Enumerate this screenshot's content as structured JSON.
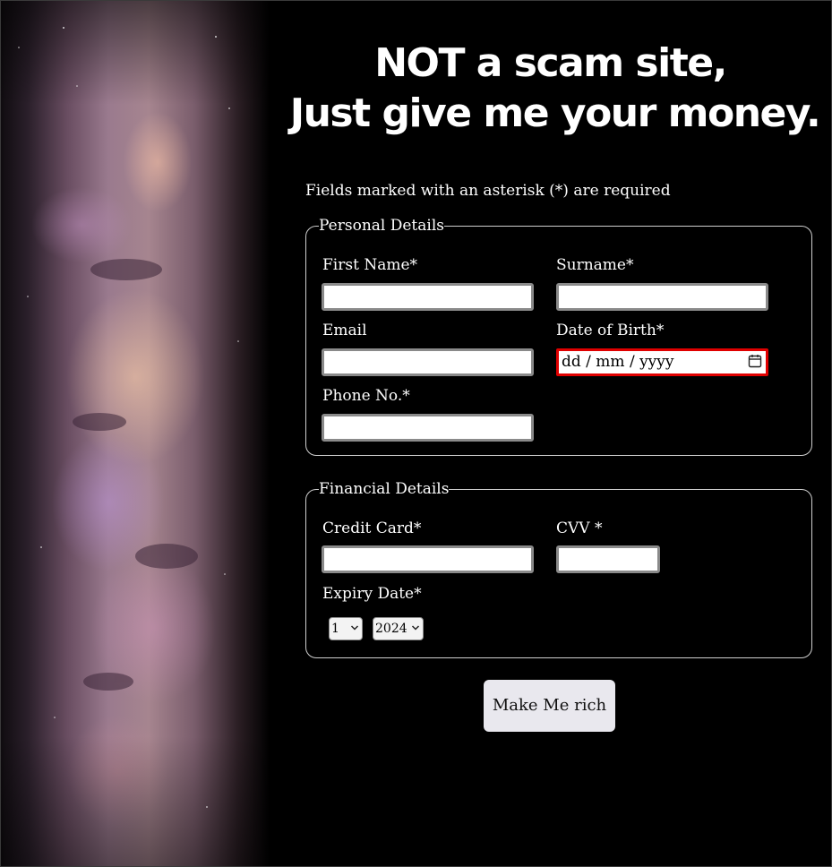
{
  "page": {
    "title_line1": "NOT a scam site,",
    "title_line2": "Just give me your money."
  },
  "form": {
    "required_note": "Fields marked with an asterisk (*) are required",
    "personal": {
      "legend": "Personal Details",
      "first_name_label": "First Name*",
      "first_name_value": "",
      "surname_label": "Surname*",
      "surname_value": "",
      "email_label": "Email",
      "email_value": "",
      "dob_label": "Date of Birth*",
      "dob_placeholder": "dd / mm / yyyy",
      "phone_label": "Phone No.*",
      "phone_value": ""
    },
    "financial": {
      "legend": "Financial Details",
      "card_label": "Credit Card*",
      "card_value": "",
      "cvv_label": "CVV *",
      "cvv_value": "",
      "expiry_label": "Expiry Date*",
      "expiry_month_selected": "1",
      "expiry_year_selected": "2024"
    },
    "submit_label": "Make Me rich"
  },
  "colors": {
    "background": "#000000",
    "text": "#ffffff",
    "invalid_border": "#e00000",
    "button_bg": "#e9e8ee"
  },
  "icons": {
    "date_picker": "calendar-icon",
    "select_arrow": "chevron-down-icon"
  }
}
